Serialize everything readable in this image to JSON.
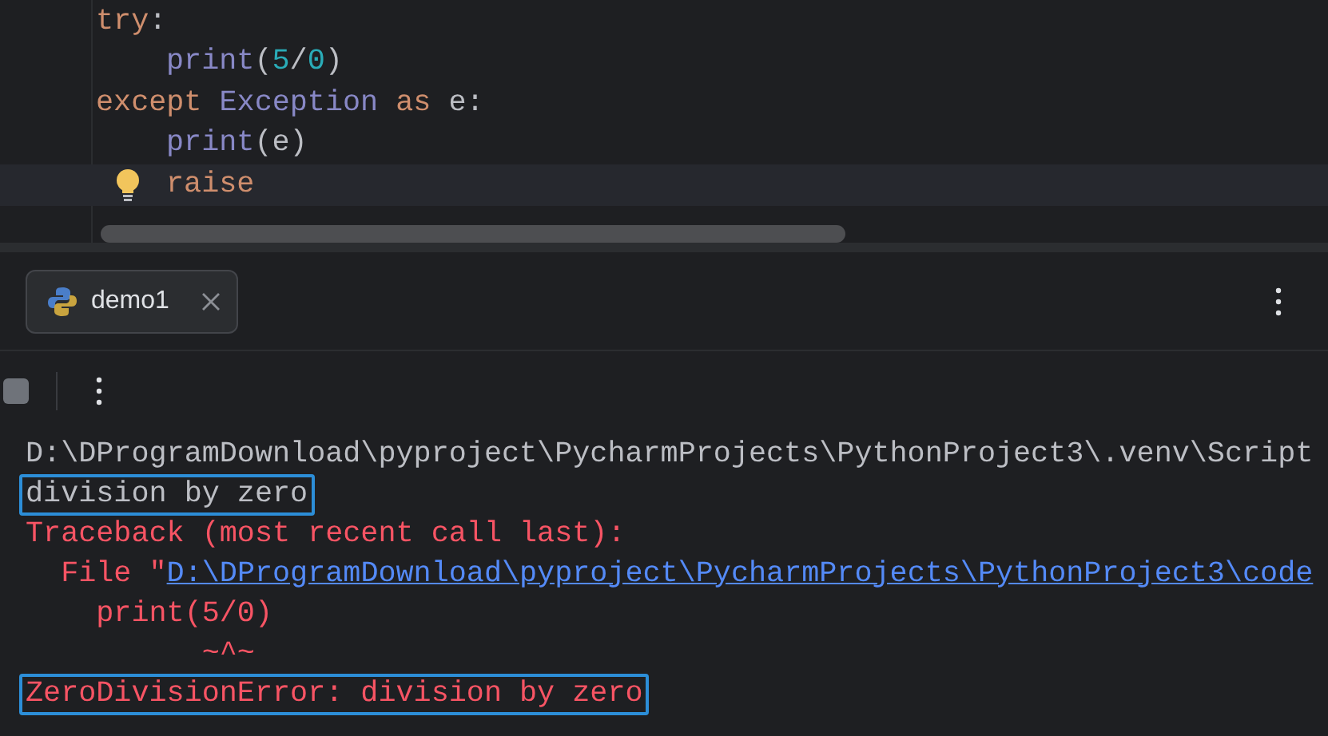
{
  "editor": {
    "lines": [
      {
        "indented": false,
        "current": false,
        "tokens": [
          {
            "kind": "keyword",
            "text": "try"
          },
          {
            "kind": "plain",
            "text": ":"
          }
        ]
      },
      {
        "indented": true,
        "current": false,
        "tokens": [
          {
            "kind": "builtin",
            "text": "print"
          },
          {
            "kind": "plain",
            "text": "("
          },
          {
            "kind": "number",
            "text": "5"
          },
          {
            "kind": "plain",
            "text": "/"
          },
          {
            "kind": "number",
            "text": "0"
          },
          {
            "kind": "plain",
            "text": ")"
          }
        ]
      },
      {
        "indented": false,
        "current": false,
        "tokens": [
          {
            "kind": "keyword",
            "text": "except"
          },
          {
            "kind": "builtin",
            "text": " Exception"
          },
          {
            "kind": "keyword",
            "text": " as"
          },
          {
            "kind": "plain",
            "text": " e:"
          }
        ]
      },
      {
        "indented": true,
        "current": false,
        "tokens": [
          {
            "kind": "builtin",
            "text": "print"
          },
          {
            "kind": "plain",
            "text": "(e)"
          }
        ]
      },
      {
        "indented": true,
        "current": true,
        "tokens": [
          {
            "kind": "keyword",
            "text": "raise"
          }
        ]
      }
    ]
  },
  "run_panel": {
    "tabs": [
      {
        "label": "demo1",
        "selected": true
      }
    ],
    "console": [
      {
        "kind": "output",
        "highlighted": false,
        "segments": [
          {
            "kind": "text",
            "text": "D:\\DProgramDownload\\pyproject\\PycharmProjects\\PythonProject3\\.venv\\Script"
          }
        ]
      },
      {
        "kind": "output",
        "highlighted": true,
        "segments": [
          {
            "kind": "text",
            "text": "division by zero"
          }
        ]
      },
      {
        "kind": "error",
        "highlighted": false,
        "segments": [
          {
            "kind": "text",
            "text": "Traceback (most recent call last):"
          }
        ]
      },
      {
        "kind": "error",
        "highlighted": false,
        "segments": [
          {
            "kind": "text",
            "text": "  File \""
          },
          {
            "kind": "link",
            "text": "D:\\DProgramDownload\\pyproject\\PycharmProjects\\PythonProject3\\code"
          }
        ]
      },
      {
        "kind": "error",
        "highlighted": false,
        "segments": [
          {
            "kind": "text",
            "text": "    print(5/0)"
          }
        ]
      },
      {
        "kind": "error",
        "highlighted": false,
        "segments": [
          {
            "kind": "text",
            "text": "          ~^~"
          }
        ]
      },
      {
        "kind": "error",
        "highlighted": true,
        "segments": [
          {
            "kind": "text",
            "text": "ZeroDivisionError: division by zero"
          }
        ]
      }
    ]
  }
}
